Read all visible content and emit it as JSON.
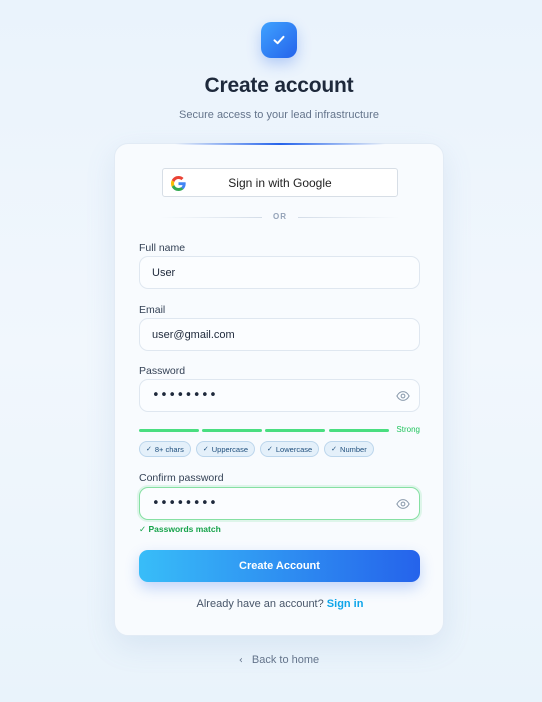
{
  "header": {
    "logo_icon": "check-icon",
    "title": "Create account",
    "subtitle": "Secure access to your lead infrastructure"
  },
  "google": {
    "icon": "google-g-icon",
    "label": "Sign in with Google"
  },
  "divider": {
    "label": "OR"
  },
  "form": {
    "full_name": {
      "label": "Full name",
      "value": "User"
    },
    "email": {
      "label": "Email",
      "value": "user@gmail.com"
    },
    "password": {
      "label": "Password",
      "value": "••••••••",
      "icon": "eye-icon"
    },
    "strength": {
      "label": "Strong",
      "level": 1.0,
      "color": "#4ade80",
      "chips": [
        "8+ chars",
        "Uppercase",
        "Lowercase",
        "Number"
      ]
    },
    "confirm_password": {
      "label": "Confirm password",
      "value": "••••••••",
      "icon": "eye-icon"
    },
    "match_message": "Passwords match",
    "submit_label": "Create Account"
  },
  "footer": {
    "prompt": "Already have an account?",
    "signin_link": "Sign in",
    "back_label": "Back to home"
  },
  "colors": {
    "accent": "#2563eb",
    "accent_light": "#38bdf8",
    "success": "#22c55e",
    "link": "#0ea5e9"
  }
}
